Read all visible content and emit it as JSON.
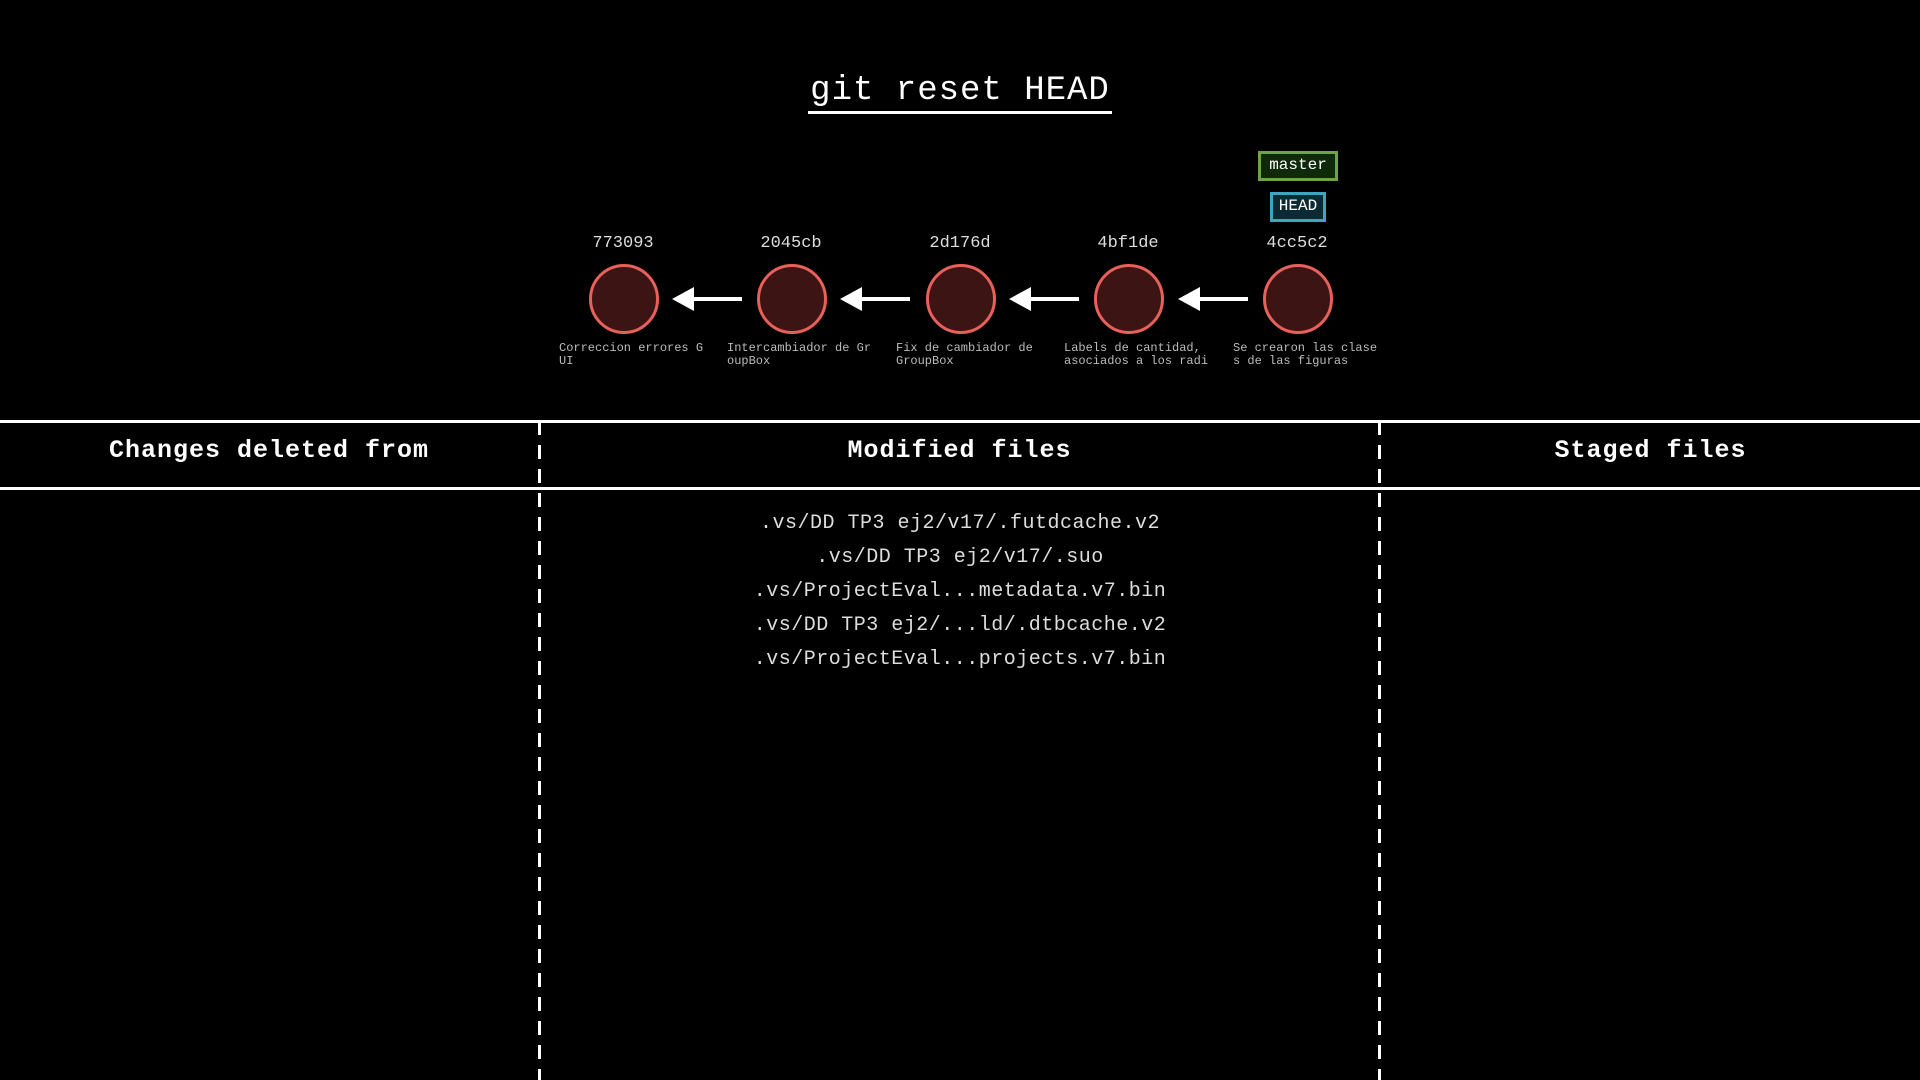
{
  "title": "git reset HEAD",
  "commits": [
    {
      "hash": "773093",
      "message": "Correccion errores G\nUI"
    },
    {
      "hash": "2045cb",
      "message": "Intercambiador de Gr\noupBox"
    },
    {
      "hash": "2d176d",
      "message": "Fix de cambiador de\nGroupBox"
    },
    {
      "hash": "4bf1de",
      "message": "Labels de cantidad,\nasociados a los radi"
    },
    {
      "hash": "4cc5c2",
      "message": "Se crearon las clase\ns de las figuras"
    }
  ],
  "refs": {
    "branch": "master",
    "head": "HEAD"
  },
  "columns": {
    "deleted": "Changes deleted from",
    "modified": "Modified files",
    "staged": "Staged files"
  },
  "modified_files": [
    ".vs/DD TP3 ej2/v17/.futdcache.v2",
    ".vs/DD TP3 ej2/v17/.suo",
    ".vs/ProjectEval...metadata.v7.bin",
    ".vs/DD TP3 ej2/...ld/.dtbcache.v2",
    ".vs/ProjectEval...projects.v7.bin"
  ],
  "staged_files": [],
  "deleted_changes": [],
  "colors": {
    "background": "#000000",
    "commit_stroke": "#e8605a",
    "commit_fill": "#3d1414",
    "branch_border": "#6fa34a",
    "head_border": "#3da5c4"
  },
  "icons": {
    "arrow": "left-arrow-icon"
  }
}
